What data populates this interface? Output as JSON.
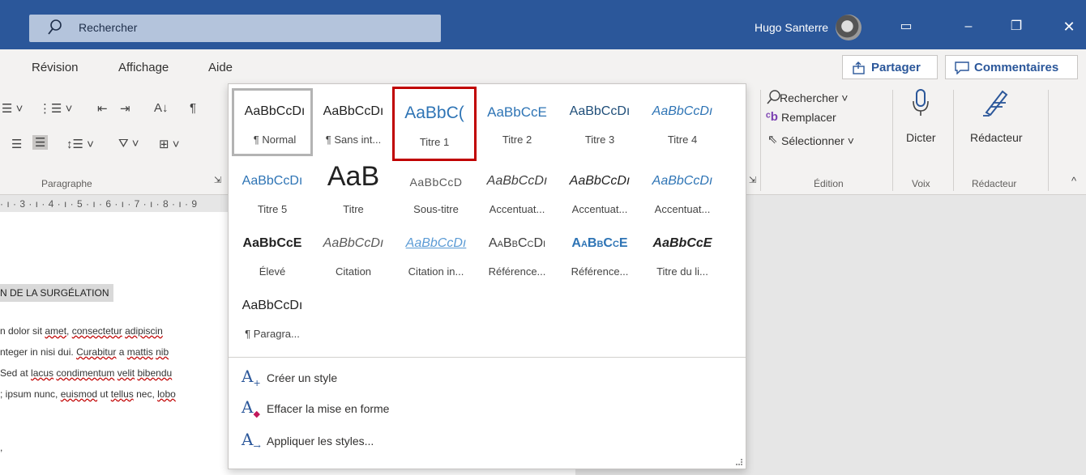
{
  "titlebar": {
    "search_label": "Rechercher",
    "user_name": "Hugo Santerre",
    "accent": "#2b579a"
  },
  "menu": {
    "tabs": [
      "Révision",
      "Affichage",
      "Aide"
    ],
    "share_label": "Partager",
    "comments_label": "Commentaires"
  },
  "ribbon": {
    "paragraph_label": "Paragraphe",
    "edition": {
      "search": "Rechercher",
      "replace": "Remplacer",
      "select": "Sélectionner",
      "label": "Édition"
    },
    "voice": {
      "button": "Dicter",
      "label": "Voix"
    },
    "editor": {
      "button": "Rédacteur",
      "label": "Rédacteur"
    }
  },
  "ruler_text": "· ı · 3 · ı · 4 · ı · 5 · ı · 6 · ı · 7 · ı · 8 · ı · 9",
  "document": {
    "heading": "N DE LA SURGÉLATION",
    "lines": [
      "n dolor sit amet, consectetur adipiscin",
      "nteger in nisi dui. Curabitur a mattis nib",
      "Sed at lacus condimentum velit bibendu",
      "; ipsum nunc, euismod ut tellus nec, lobo",
      ","
    ]
  },
  "gallery": {
    "styles": [
      {
        "preview": "AaBbCcDı",
        "name": "¶ Normal"
      },
      {
        "preview": "AaBbCcDı",
        "name": "¶ Sans int..."
      },
      {
        "preview": "AaBbC(",
        "name": "Titre 1"
      },
      {
        "preview": "AaBbCcE",
        "name": "Titre 2"
      },
      {
        "preview": "AaBbCcDı",
        "name": "Titre 3"
      },
      {
        "preview": "AaBbCcDı",
        "name": "Titre 4"
      },
      {
        "preview": "AaBbCcDı",
        "name": "Titre 5"
      },
      {
        "preview": "AaB",
        "name": "Titre"
      },
      {
        "preview": "AaBbCcD",
        "name": "Sous-titre"
      },
      {
        "preview": "AaBbCcDı",
        "name": "Accentuat..."
      },
      {
        "preview": "AaBbCcDı",
        "name": "Accentuat..."
      },
      {
        "preview": "AaBbCcDı",
        "name": "Accentuat..."
      },
      {
        "preview": "AaBbCcE",
        "name": "Élevé"
      },
      {
        "preview": "AaBbCcDı",
        "name": "Citation"
      },
      {
        "preview": "AaBbCcDı",
        "name": "Citation in..."
      },
      {
        "preview": "AaBbCcDı",
        "name": "Référence..."
      },
      {
        "preview": "AaBbCcE",
        "name": "Référence..."
      },
      {
        "preview": "AaBbCcE",
        "name": "Titre du li..."
      },
      {
        "preview": "AaBbCcDı",
        "name": "¶ Paragra..."
      }
    ],
    "actions": [
      {
        "icon": "create-style-icon",
        "label": "Créer un style"
      },
      {
        "icon": "clear-format-icon",
        "label": "Effacer la mise en forme"
      },
      {
        "icon": "apply-styles-icon",
        "label": "Appliquer les styles..."
      }
    ]
  }
}
